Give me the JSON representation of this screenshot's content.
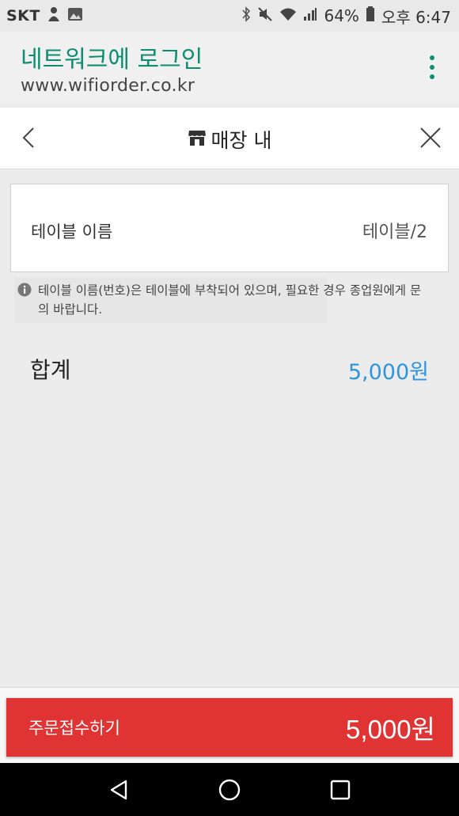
{
  "status_bar": {
    "carrier": "SKT",
    "battery": "64%",
    "time": "오후 6:47"
  },
  "portal": {
    "title": "네트워크에 로그인",
    "url": "www.wifiorder.co.kr"
  },
  "nav": {
    "title": "매장 내"
  },
  "table": {
    "label": "테이블 이름",
    "value": "테이블/2"
  },
  "note": {
    "text": "테이블 이름(번호)은 테이블에 부착되어 있으며, 필요한 경우 종업원에게 문의 바랍니다."
  },
  "total": {
    "label": "합계",
    "value": "5,000원"
  },
  "order_button": {
    "label": "주문접수하기",
    "amount": "5,000원"
  },
  "colors": {
    "accent_green": "#0e8c70",
    "price_blue": "#2f95dc",
    "order_red": "#e03434"
  }
}
